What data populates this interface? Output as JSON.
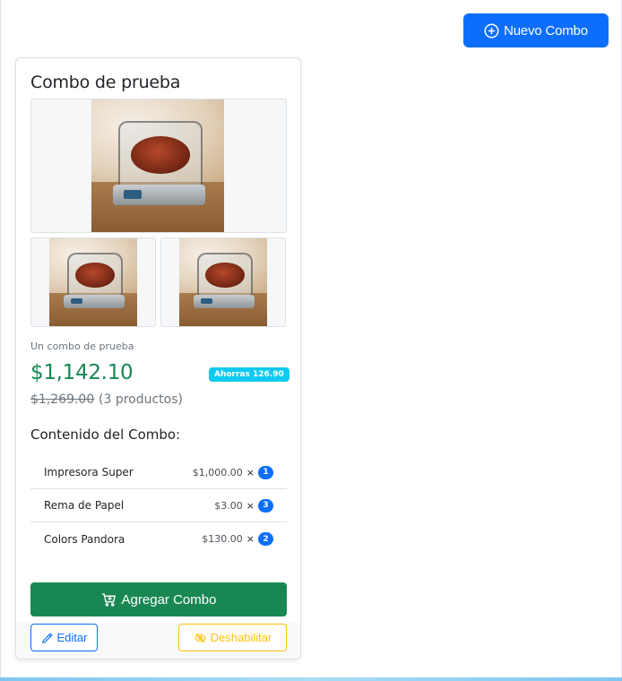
{
  "header": {
    "new_button_label": "Nuevo Combo",
    "new_button_icon": "plus-circle-icon"
  },
  "combo": {
    "title": "Combo de prueba",
    "images": [
      "main-product-photo",
      "thumbnail-photo",
      "thumbnail-photo"
    ],
    "description": "Un combo de prueba",
    "price": "$1,142.10",
    "savings_badge": "Ahorras 126.90",
    "original_price": "$1,269.00",
    "product_count": "(3 productos)",
    "contents_title": "Contenido del Combo:",
    "items": [
      {
        "name": "Impresora Super",
        "price": "$1,000.00",
        "times": "×",
        "qty": "1"
      },
      {
        "name": "Rema de Papel",
        "price": "$3.00",
        "times": "×",
        "qty": "3"
      },
      {
        "name": "Colors Pandora",
        "price": "$130.00",
        "times": "×",
        "qty": "2"
      }
    ],
    "add_button_label": "Agregar Combo",
    "add_button_icon": "cart-plus-icon",
    "edit_button_label": "Editar",
    "edit_button_icon": "pencil-icon",
    "disable_button_label": "Deshabilitar",
    "disable_button_icon": "eye-slash-icon"
  },
  "colors": {
    "primary": "#0d6efd",
    "success": "#198754",
    "info": "#0dcaf0",
    "warning": "#ffc107"
  }
}
